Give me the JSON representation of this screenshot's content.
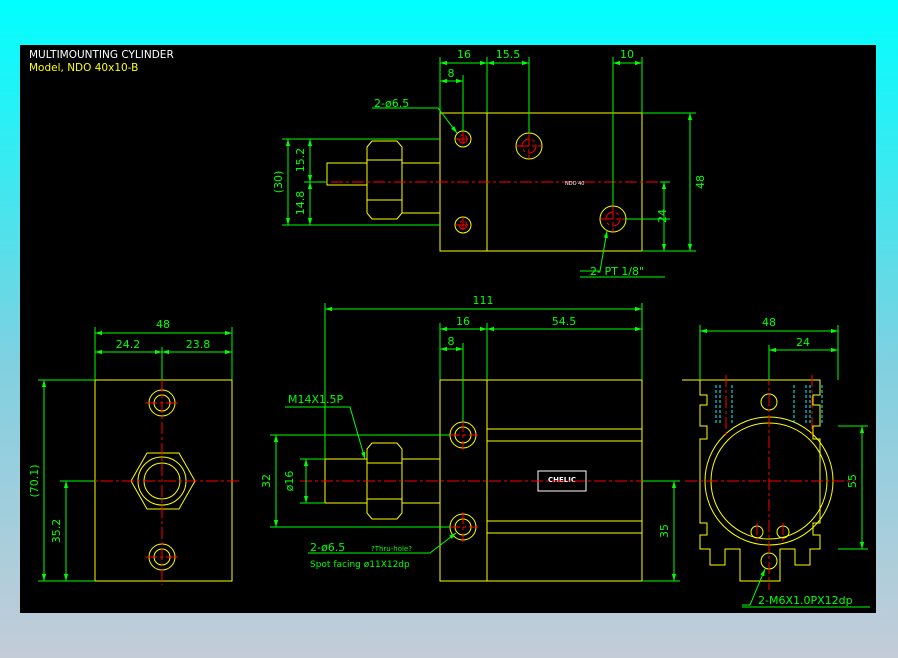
{
  "title_block": {
    "title": "MULTIMOUNTING CYLINDER",
    "model": "Model, NDO 40x10-B"
  },
  "top_view": {
    "dim_16": "16",
    "dim_15_5": "15.5",
    "dim_10": "10",
    "dim_8": "8",
    "hole_label": "2-ø6.5",
    "dim_30": "(30)",
    "dim_15_2": "15.2",
    "dim_14_8": "14.8",
    "dim_48": "48",
    "dim_24": "24",
    "port_label": "2- PT 1/8\"",
    "body_mark": "NDO 40"
  },
  "front_view": {
    "dim_111": "111",
    "dim_16": "16",
    "dim_54_5": "54.5",
    "dim_8": "8",
    "thread_label": "M14X1.5P",
    "dim_32": "32",
    "dim_phi16": "ø16",
    "dim_35": "35",
    "hole_label": "2-ø6.5",
    "hole_note": "?Thru-hole?",
    "spot_facing": "Spot facing  ø11X12dp",
    "logo_text": "CHELIC"
  },
  "left_view": {
    "dim_48": "48",
    "dim_24_2": "24.2",
    "dim_23_8": "23.8",
    "dim_70_1": "(70.1)",
    "dim_35_2": "35.2"
  },
  "right_view": {
    "dim_48": "48",
    "dim_24": "24",
    "dim_55": "55",
    "tap_label": "2-M6X1.0PX12dp"
  },
  "colors": {
    "outline": "#ffff00",
    "dimension": "#00ff00",
    "center_line": "#ff0000",
    "detail": "#00ffff",
    "label": "#ffffff"
  }
}
